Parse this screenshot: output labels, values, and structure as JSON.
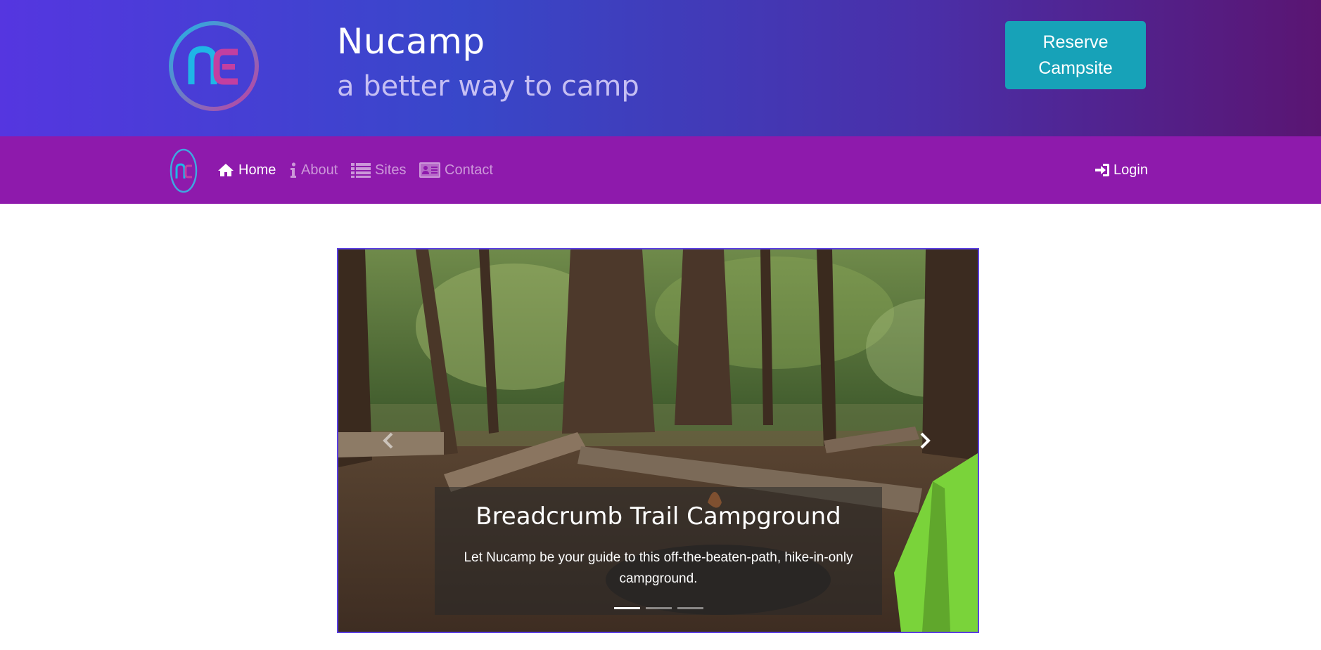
{
  "header": {
    "brand_title": "Nucamp",
    "brand_subtitle": "a better way to camp",
    "reserve_button": "Reserve\nCampsite",
    "logo_icon": "nucamp-logo-icon"
  },
  "navbar": {
    "items": [
      {
        "label": "Home",
        "icon": "home-icon",
        "active": true
      },
      {
        "label": "About",
        "icon": "info-icon",
        "active": false
      },
      {
        "label": "Sites",
        "icon": "list-icon",
        "active": false
      },
      {
        "label": "Contact",
        "icon": "address-card-icon",
        "active": false
      }
    ],
    "login": {
      "label": "Login",
      "icon": "sign-in-icon"
    }
  },
  "carousel": {
    "caption_title": "Breadcrumb Trail Campground",
    "caption_text": "Let Nucamp be your guide to this off-the-beaten-path, hike-in-only campground.",
    "active_slide": 1,
    "slide_count": 3
  },
  "colors": {
    "header_gradient_start": "#5536e0",
    "header_gradient_end": "#5a1572",
    "navbar_bg": "#8e1aac",
    "reserve_button_bg": "#17a2b8",
    "carousel_border": "#5a3fe0"
  }
}
